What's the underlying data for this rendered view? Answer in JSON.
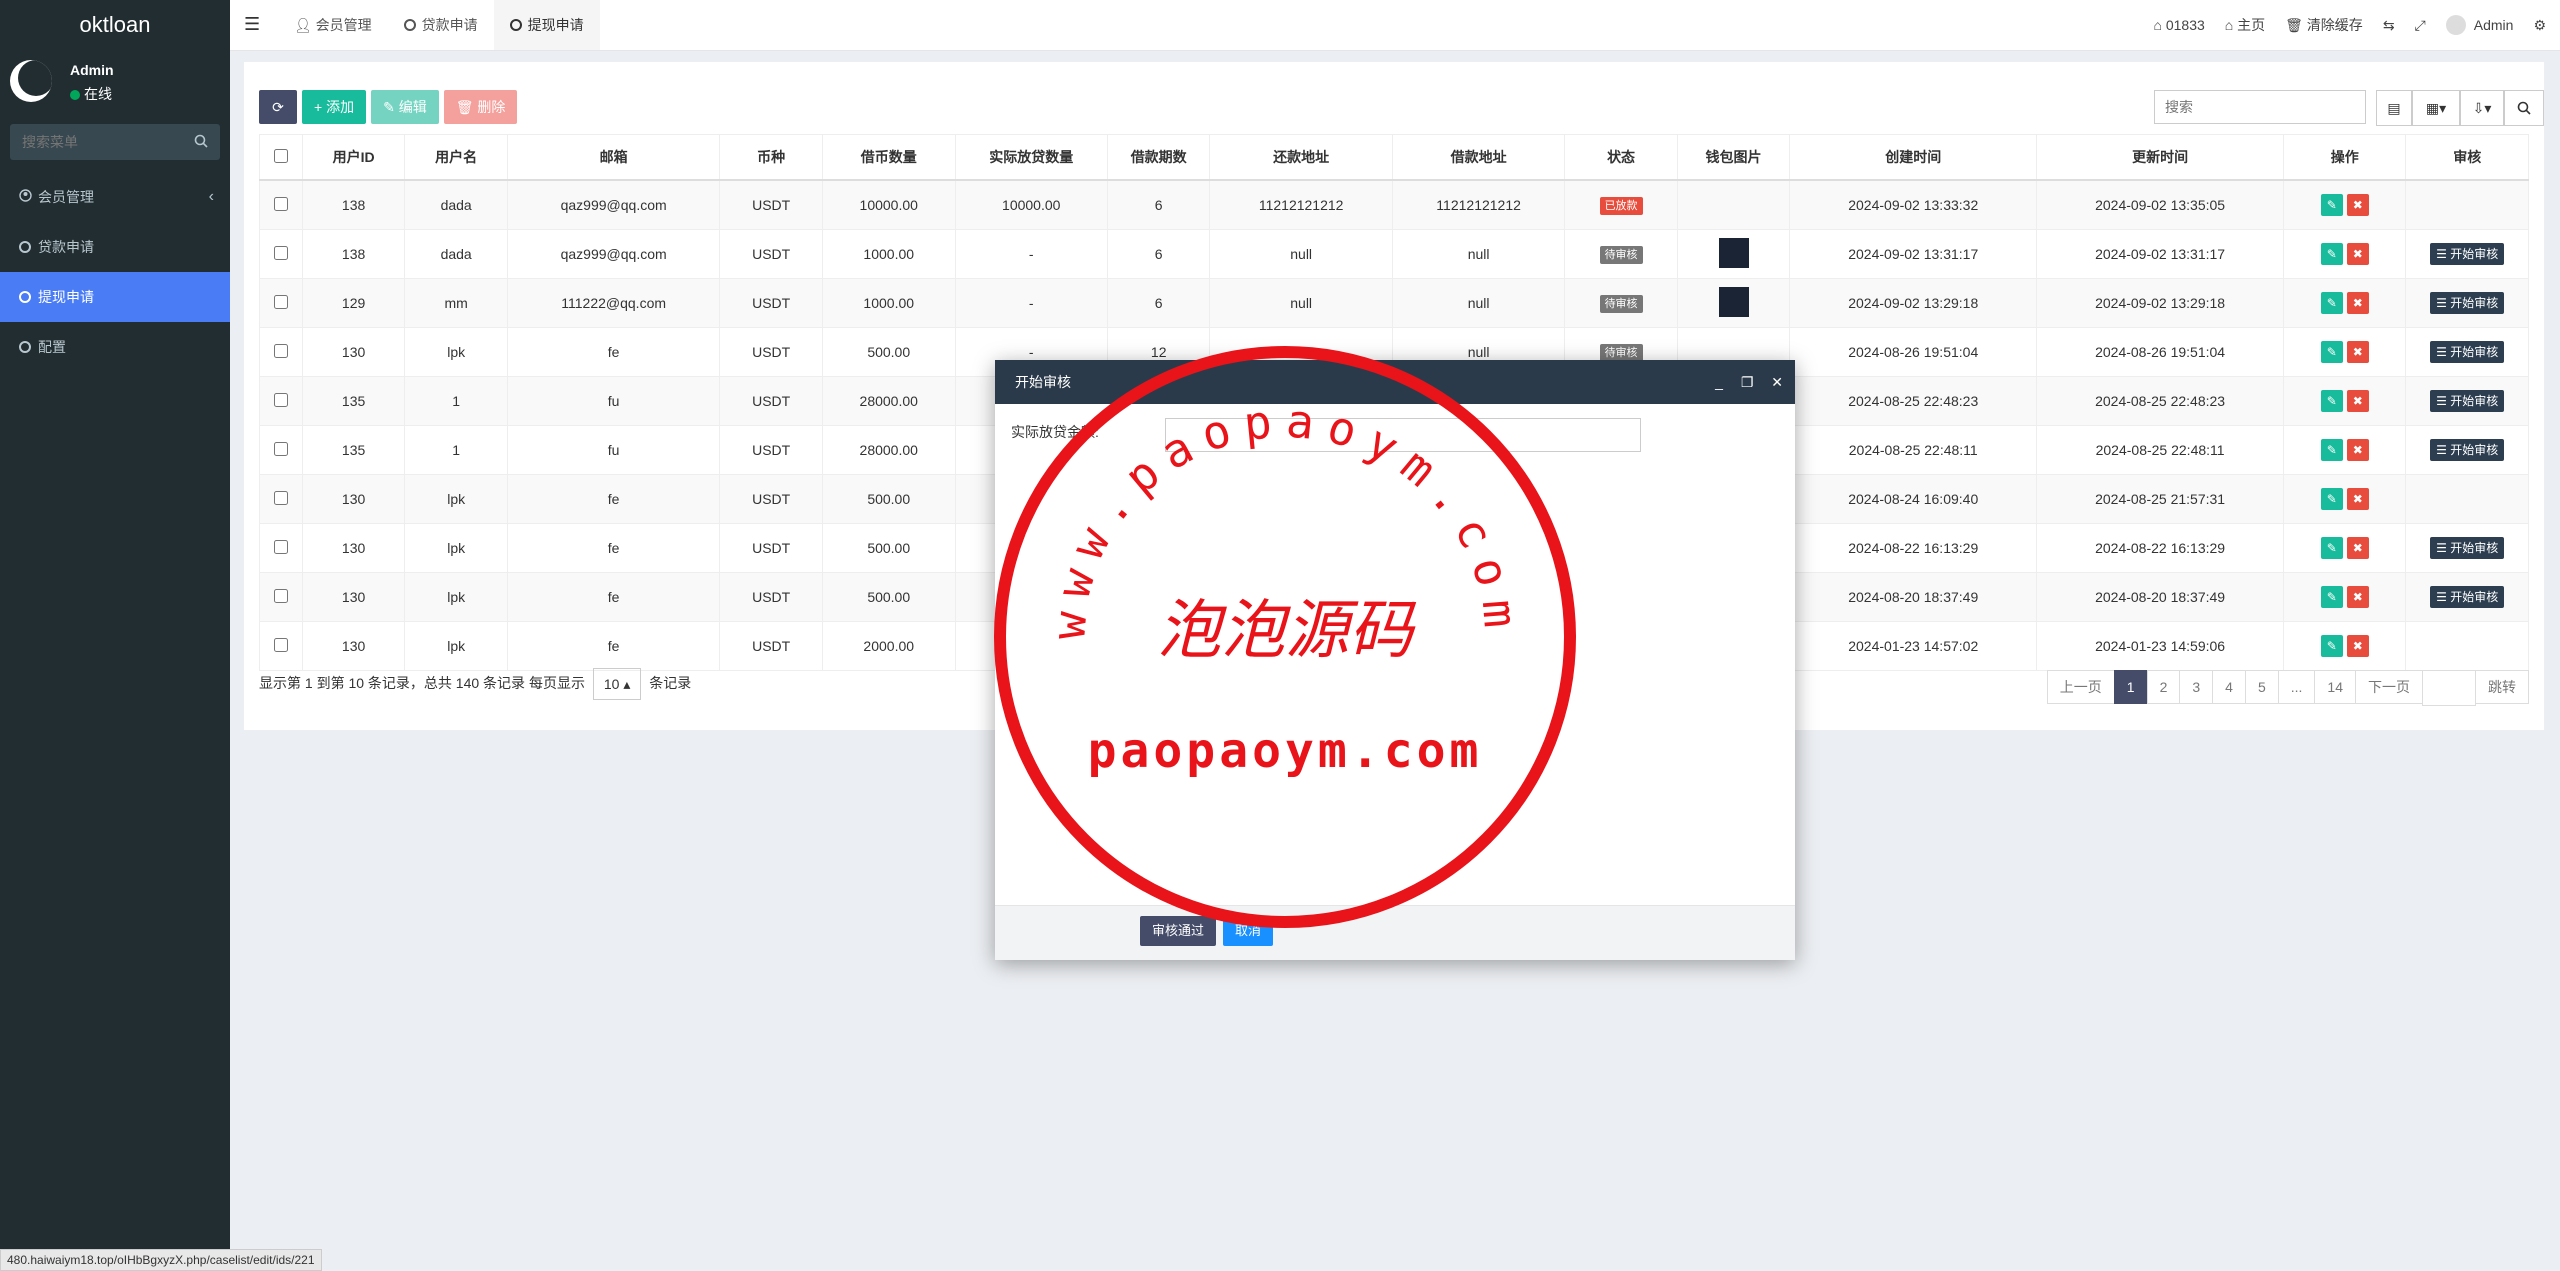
{
  "app": {
    "logo": "oktloan"
  },
  "user": {
    "name": "Admin",
    "status": "在线"
  },
  "sidebar": {
    "search_placeholder": "搜索菜单",
    "items": [
      {
        "label": "会员管理"
      },
      {
        "label": "贷款申请"
      },
      {
        "label": "提现申请"
      },
      {
        "label": "配置"
      }
    ]
  },
  "header": {
    "tabs": [
      {
        "label": "会员管理"
      },
      {
        "label": "贷款申请"
      },
      {
        "label": "提现申请"
      }
    ],
    "right": {
      "code": "01833",
      "home": "主页",
      "clear_cache": "清除缓存",
      "admin": "Admin"
    }
  },
  "toolbar": {
    "add": "添加",
    "edit": "编辑",
    "delete": "删除",
    "search_placeholder": "搜索"
  },
  "table": {
    "headers": [
      "用户ID",
      "用户名",
      "邮箱",
      "币种",
      "借币数量",
      "实际放贷数量",
      "借款期数",
      "还款地址",
      "借款地址",
      "状态",
      "钱包图片",
      "创建时间",
      "更新时间",
      "操作",
      "审核"
    ],
    "rows": [
      {
        "uid": "138",
        "uname": "dada",
        "email": "qaz999@qq.com",
        "coin": "USDT",
        "amount": "10000.00",
        "actual": "10000.00",
        "periods": "6",
        "repay": "11212121212",
        "borrow": "11212121212",
        "status": "已放款",
        "created": "2024-09-02 13:33:32",
        "updated": "2024-09-02 13:35:05",
        "audit": ""
      },
      {
        "uid": "138",
        "uname": "dada",
        "email": "qaz999@qq.com",
        "coin": "USDT",
        "amount": "1000.00",
        "actual": "-",
        "periods": "6",
        "repay": "null",
        "borrow": "null",
        "status": "待审核",
        "created": "2024-09-02 13:31:17",
        "updated": "2024-09-02 13:31:17",
        "audit": "开始审核"
      },
      {
        "uid": "129",
        "uname": "mm",
        "email": "111222@qq.com",
        "coin": "USDT",
        "amount": "1000.00",
        "actual": "-",
        "periods": "6",
        "repay": "null",
        "borrow": "null",
        "status": "待审核",
        "created": "2024-09-02 13:29:18",
        "updated": "2024-09-02 13:29:18",
        "audit": "开始审核"
      },
      {
        "uid": "130",
        "uname": "lpk",
        "email": "fe",
        "coin": "USDT",
        "amount": "500.00",
        "actual": "-",
        "periods": "12",
        "repay": "",
        "borrow": "null",
        "status": "待审核",
        "created": "2024-08-26 19:51:04",
        "updated": "2024-08-26 19:51:04",
        "audit": "开始审核"
      },
      {
        "uid": "135",
        "uname": "1",
        "email": "fu",
        "coin": "USDT",
        "amount": "28000.00",
        "actual": "",
        "periods": "",
        "repay": "",
        "borrow": "",
        "status": "",
        "created": "2024-08-25 22:48:23",
        "updated": "2024-08-25 22:48:23",
        "audit": "开始审核"
      },
      {
        "uid": "135",
        "uname": "1",
        "email": "fu",
        "coin": "USDT",
        "amount": "28000.00",
        "actual": "",
        "periods": "",
        "repay": "",
        "borrow": "",
        "status": "",
        "created": "2024-08-25 22:48:11",
        "updated": "2024-08-25 22:48:11",
        "audit": "开始审核"
      },
      {
        "uid": "130",
        "uname": "lpk",
        "email": "fe",
        "coin": "USDT",
        "amount": "500.00",
        "actual": "",
        "periods": "",
        "repay": "",
        "borrow": "",
        "status": "",
        "created": "2024-08-24 16:09:40",
        "updated": "2024-08-25 21:57:31",
        "audit": ""
      },
      {
        "uid": "130",
        "uname": "lpk",
        "email": "fe",
        "coin": "USDT",
        "amount": "500.00",
        "actual": "",
        "periods": "",
        "repay": "",
        "borrow": "",
        "status": "",
        "created": "2024-08-22 16:13:29",
        "updated": "2024-08-22 16:13:29",
        "audit": "开始审核"
      },
      {
        "uid": "130",
        "uname": "lpk",
        "email": "fe",
        "coin": "USDT",
        "amount": "500.00",
        "actual": "",
        "periods": "",
        "repay": "",
        "borrow": "",
        "status": "",
        "created": "2024-08-20 18:37:49",
        "updated": "2024-08-20 18:37:49",
        "audit": "开始审核"
      },
      {
        "uid": "130",
        "uname": "lpk",
        "email": "fe",
        "coin": "USDT",
        "amount": "2000.00",
        "actual": "",
        "periods": "",
        "repay": "",
        "borrow": "",
        "status": "",
        "created": "2024-01-23 14:57:02",
        "updated": "2024-01-23 14:59:06",
        "audit": ""
      }
    ]
  },
  "pagination": {
    "info_prefix": "显示第 1 到第 10 条记录，总共 140 条记录 每页显示",
    "page_size": "10",
    "info_suffix": "条记录",
    "prev": "上一页",
    "pages": [
      "1",
      "2",
      "3",
      "4",
      "5",
      "...",
      "14"
    ],
    "next": "下一页",
    "jump": "跳转"
  },
  "modal": {
    "title": "开始审核",
    "label": "实际放贷金额:",
    "ok": "审核通过",
    "cancel": "取消"
  },
  "watermark": {
    "arc": "www.paopaoym.com",
    "center": "泡泡源码",
    "bottom": "paopaoym.com"
  },
  "statusbar": {
    "url": "480.haiwaiym18.top/oIHbBgxyzX.php/caselist/edit/ids/221"
  },
  "colors": {
    "sidebar": "#222d32",
    "accent": "#4a7cf6",
    "green": "#18bc9c",
    "red": "#e74c3c",
    "stamp": "#e8141a"
  }
}
